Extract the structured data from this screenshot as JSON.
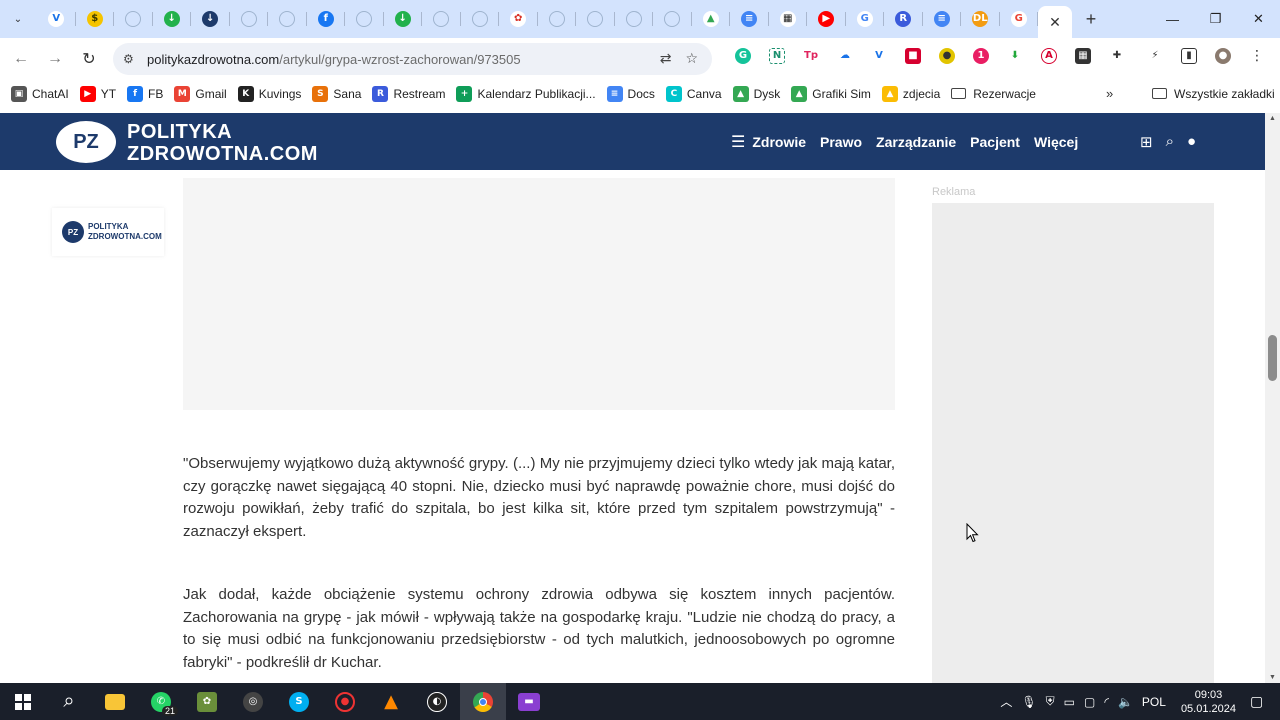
{
  "browser": {
    "tab_favicons": [
      {
        "name": "tab-favicon-1",
        "glyph": "V",
        "bg": "#ffffff",
        "fg": "#1a73e8"
      },
      {
        "name": "tab-favicon-2",
        "glyph": "$",
        "bg": "#f5c400",
        "fg": "#3a3a00"
      },
      {
        "name": "tab-favicon-3",
        "glyph": "",
        "bg": "ring",
        "fg": ""
      },
      {
        "name": "tab-favicon-4",
        "glyph": "↓",
        "bg": "#22b14c",
        "fg": "#ffffff"
      },
      {
        "name": "tab-favicon-5",
        "glyph": "↓",
        "bg": "#1d3a6b",
        "fg": "#ffffff"
      },
      {
        "name": "tab-favicon-6",
        "glyph": "",
        "bg": "ring",
        "fg": ""
      },
      {
        "name": "tab-favicon-7",
        "glyph": "",
        "bg": "ring",
        "fg": ""
      },
      {
        "name": "tab-favicon-8",
        "glyph": "f",
        "bg": "#1877f2",
        "fg": "#ffffff"
      },
      {
        "name": "tab-favicon-9",
        "glyph": "",
        "bg": "ring",
        "fg": ""
      },
      {
        "name": "tab-favicon-10",
        "glyph": "↓",
        "bg": "#22b14c",
        "fg": "#ffffff"
      },
      {
        "name": "tab-favicon-11",
        "glyph": "",
        "bg": "ring",
        "fg": ""
      },
      {
        "name": "tab-favicon-12",
        "glyph": "",
        "bg": "ring",
        "fg": ""
      },
      {
        "name": "tab-favicon-13",
        "glyph": "✿",
        "bg": "#ffffff",
        "fg": "#d93025"
      },
      {
        "name": "tab-favicon-14",
        "glyph": "",
        "bg": "ring",
        "fg": ""
      },
      {
        "name": "tab-favicon-15",
        "glyph": "",
        "bg": "ring",
        "fg": ""
      },
      {
        "name": "tab-favicon-16",
        "glyph": "",
        "bg": "ring",
        "fg": ""
      },
      {
        "name": "tab-favicon-17",
        "glyph": "",
        "bg": "ring",
        "fg": ""
      },
      {
        "name": "tab-favicon-18",
        "glyph": "▲",
        "bg": "#ffffff",
        "fg": "#34a853"
      },
      {
        "name": "tab-favicon-19",
        "glyph": "≡",
        "bg": "#4285f4",
        "fg": "#ffffff"
      },
      {
        "name": "tab-favicon-20",
        "glyph": "▦",
        "bg": "#ffffff",
        "fg": "#222222"
      },
      {
        "name": "tab-favicon-21",
        "glyph": "▶",
        "bg": "#ff0000",
        "fg": "#ffffff"
      },
      {
        "name": "tab-favicon-22",
        "glyph": "G",
        "bg": "#ffffff",
        "fg": "#4285f4"
      },
      {
        "name": "tab-favicon-23",
        "glyph": "R",
        "bg": "#3b5bdb",
        "fg": "#ffffff"
      },
      {
        "name": "tab-favicon-24",
        "glyph": "≡",
        "bg": "#4285f4",
        "fg": "#ffffff"
      },
      {
        "name": "tab-favicon-25",
        "glyph": "DL",
        "bg": "#f39c12",
        "fg": "#ffffff"
      },
      {
        "name": "tab-favicon-26",
        "glyph": "G",
        "bg": "#ffffff",
        "fg": "#ea4335"
      }
    ],
    "url_host": "polityka­zdrowotna.com",
    "url_path": "/artykul/grypa-wzrost-zachorowan/973505",
    "bookmarks": [
      {
        "label": "ChatAI",
        "glyph": "▣",
        "color": "#555555"
      },
      {
        "label": "YT",
        "glyph": "▶",
        "color": "#ff0000"
      },
      {
        "label": "FB",
        "glyph": "f",
        "color": "#1877f2"
      },
      {
        "label": "Gmail",
        "glyph": "M",
        "color": "#ea4335"
      },
      {
        "label": "Kuvings",
        "glyph": "K",
        "color": "#222222"
      },
      {
        "label": "Sana",
        "glyph": "S",
        "color": "#e8710a"
      },
      {
        "label": "Restream",
        "glyph": "R",
        "color": "#3b5bdb"
      },
      {
        "label": "Kalendarz Publikacji...",
        "glyph": "+",
        "color": "#0f9d58"
      },
      {
        "label": "Docs",
        "glyph": "≡",
        "color": "#4285f4"
      },
      {
        "label": "Canva",
        "glyph": "C",
        "color": "#00c4cc"
      },
      {
        "label": "Dysk",
        "glyph": "▲",
        "color": "#34a853"
      },
      {
        "label": "Grafiki Sim",
        "glyph": "▲",
        "color": "#34a853"
      },
      {
        "label": "zdjecia",
        "glyph": "▲",
        "color": "#fbbc04"
      },
      {
        "label": "Rezerwacje",
        "glyph": "",
        "color": "folder"
      }
    ],
    "bookmarks_more": "»",
    "all_bookmarks": "Wszystkie zakładki"
  },
  "site": {
    "logo_badge": "PZ",
    "logo_line1": "POLITYKA",
    "logo_line2": "ZDROWOTNA.COM",
    "nav": [
      "Zdrowie",
      "Prawo",
      "Zarządzanie",
      "Pacjent",
      "Więcej"
    ],
    "side_logo_line1": "POLITYKA",
    "side_logo_line2": "ZDROWOTNA.COM",
    "ad_label": "Reklama"
  },
  "article": {
    "p1": "\"Obserwujemy wyjątkowo dużą aktywność grypy. (...) My nie przyjmujemy dzieci tylko wtedy jak mają katar, czy gorączkę nawet sięgającą 40 stopni. Nie, dziecko musi być naprawdę poważnie chore, musi dojść do rozwoju powikłań, żeby trafić do szpitala, bo jest kilka sit, które przed tym szpitalem powstrzymują\" - zaznaczył ekspert.",
    "p2": "Jak dodał, każde obciążenie systemu ochrony zdrowia odbywa się kosztem innych pacjentów. Zachorowania na grypę - jak mówił - wpływają także na gospodarkę kraju. \"Ludzie nie chodzą do pracy, a to się musi odbić na funkcjonowaniu przedsiębiorstw - od tych malutkich, jednoosobowych po ogromne fabryki\" - podkreślił dr Kuchar."
  },
  "taskbar": {
    "whatsapp_badge": "21",
    "language": "POL",
    "time": "09:03",
    "date": "05.01.2024"
  },
  "colors": {
    "site_header": "#1d3a6b",
    "tabstrip": "#d3e3fd",
    "taskbar": "#1a1f2a"
  }
}
